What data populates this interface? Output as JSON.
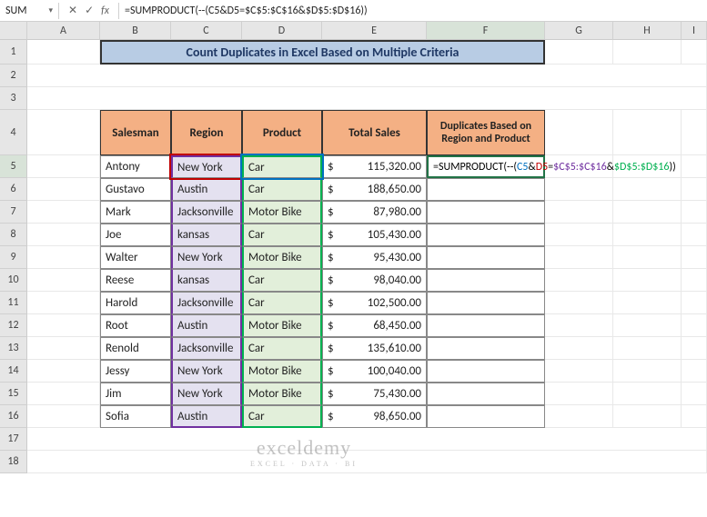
{
  "name_box": "SUM",
  "formula_bar": "=SUMPRODUCT(--(C5&D5=$C$5:$C$16&$D$5:$D$16))",
  "columns": [
    "A",
    "B",
    "C",
    "D",
    "E",
    "F",
    "G",
    "H",
    "I"
  ],
  "rows": [
    "1",
    "2",
    "3",
    "4",
    "5",
    "6",
    "7",
    "8",
    "9",
    "10",
    "11",
    "12",
    "13",
    "14",
    "15",
    "16",
    "17",
    "18"
  ],
  "title": "Count Duplicates in Excel Based on Multiple Criteria",
  "headers": {
    "salesman": "Salesman",
    "region": "Region",
    "product": "Product",
    "total_sales": "Total Sales",
    "duplicates": "Duplicates Based on Region and Product"
  },
  "data": [
    {
      "salesman": "Antony",
      "region": "New York",
      "product": "Car",
      "sales": "115,320.00"
    },
    {
      "salesman": "Gustavo",
      "region": "Austin",
      "product": "Car",
      "sales": "188,650.00"
    },
    {
      "salesman": "Mark",
      "region": "Jacksonville",
      "product": "Motor Bike",
      "sales": "87,980.00"
    },
    {
      "salesman": "Joe",
      "region": "kansas",
      "product": "Car",
      "sales": "105,430.00"
    },
    {
      "salesman": "Walter",
      "region": "New York",
      "product": "Motor Bike",
      "sales": "95,430.00"
    },
    {
      "salesman": "Reese",
      "region": "kansas",
      "product": "Car",
      "sales": "98,040.00"
    },
    {
      "salesman": "Harold",
      "region": "Jacksonville",
      "product": "Car",
      "sales": "102,500.00"
    },
    {
      "salesman": "Root",
      "region": "Austin",
      "product": "Motor Bike",
      "sales": "68,450.00"
    },
    {
      "salesman": "Renold",
      "region": "Jacksonville",
      "product": "Car",
      "sales": "135,610.00"
    },
    {
      "salesman": "Jessy",
      "region": "New York",
      "product": "Motor Bike",
      "sales": "100,040.00"
    },
    {
      "salesman": "Jim",
      "region": "New York",
      "product": "Motor Bike",
      "sales": "75,430.00"
    },
    {
      "salesman": "Sofia",
      "region": "Austin",
      "product": "Car",
      "sales": "98,650.00"
    }
  ],
  "currency": "$",
  "active_formula": {
    "p1": "=SUMPRODUCT(--(",
    "c5": "C5",
    "amp": "&",
    "d5": "D5",
    "eq": "=",
    "range1": "$C$5:$C$16",
    "range2": "$D$5:$D$16",
    "p2": "))"
  },
  "icons": {
    "cancel": "✕",
    "enter": "✓"
  },
  "watermark": {
    "main": "exceldemy",
    "sub": "EXCEL · DATA · BI"
  }
}
